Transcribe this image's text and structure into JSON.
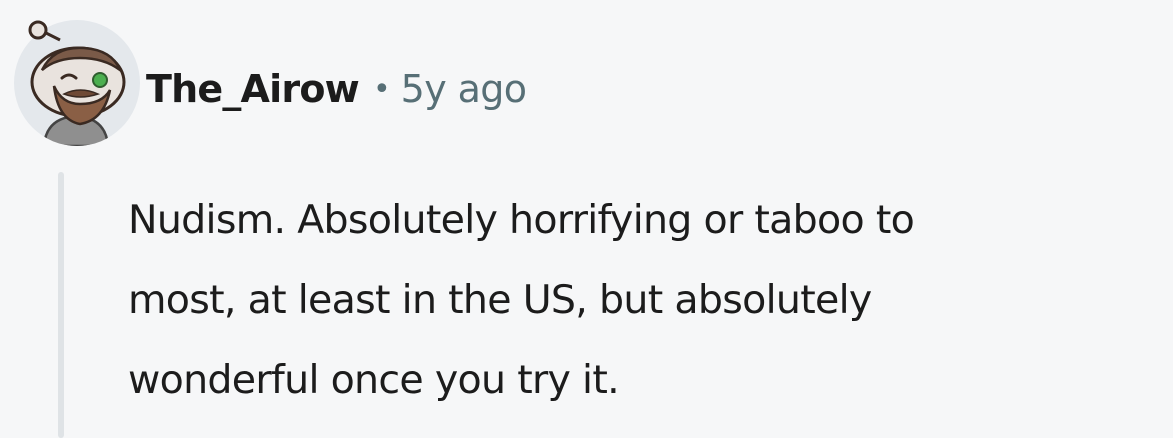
{
  "comment": {
    "author": "The_Airow",
    "separator": "•",
    "timestamp": "5y ago",
    "avatar_icon": "snoo-avatar-icon",
    "body": "Nudism. Absolutely horrifying or taboo to\nmost, at least in the US, but absolutely\nwonderful once you try it."
  },
  "colors": {
    "background": "#f6f7f8",
    "text": "#1c1c1c",
    "meta": "#576f76",
    "thread_line": "#dfe3e6"
  }
}
